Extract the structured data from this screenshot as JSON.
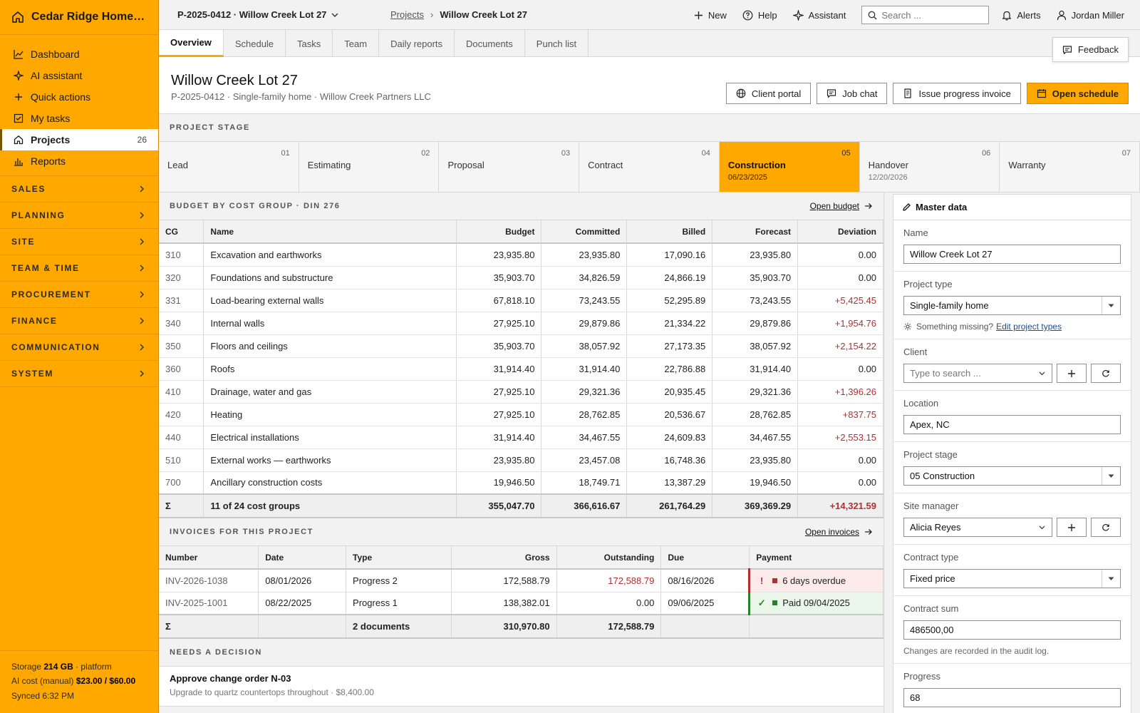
{
  "brand": {
    "name": "Cedar Ridge Homes L..."
  },
  "nav": [
    {
      "label": "Dashboard",
      "icon": "chart-line-icon"
    },
    {
      "label": "AI assistant",
      "icon": "sparkle-icon"
    },
    {
      "label": "Quick actions",
      "icon": "plus-icon"
    },
    {
      "label": "My tasks",
      "icon": "checkbox-icon"
    },
    {
      "label": "Projects",
      "icon": "home-icon",
      "count": "26",
      "active": true
    },
    {
      "label": "Reports",
      "icon": "bar-chart-icon"
    }
  ],
  "groups": [
    "SALES",
    "PLANNING",
    "SITE",
    "TEAM & TIME",
    "PROCUREMENT",
    "FINANCE",
    "COMMUNICATION",
    "SYSTEM"
  ],
  "footer": {
    "storage_label": "Storage",
    "storage_value": "214 GB",
    "storage_suffix": "· platform",
    "ai_label": "AI cost (manual)",
    "ai_value": "$23.00 / $60.00",
    "synced": "Synced 6:32 PM"
  },
  "topbar": {
    "project": "P-2025-0412 · Willow Creek Lot 27",
    "crumb_parent": "Projects",
    "crumb_current": "Willow Creek Lot 27",
    "new_label": "New",
    "help_label": "Help",
    "assistant_label": "Assistant",
    "search_placeholder": "Search ...",
    "alerts_label": "Alerts",
    "user_name": "Jordan Miller"
  },
  "tabs": [
    "Overview",
    "Schedule",
    "Tasks",
    "Team",
    "Daily reports",
    "Documents",
    "Punch list"
  ],
  "feedback_label": "Feedback",
  "header": {
    "title": "Willow Creek Lot 27",
    "subtitle": "P-2025-0412 · Single-family home · Willow Creek Partners LLC",
    "btn_client_portal": "Client portal",
    "btn_job_chat": "Job chat",
    "btn_invoice": "Issue progress invoice",
    "btn_schedule": "Open schedule"
  },
  "stage_label": "PROJECT STAGE",
  "stages": [
    {
      "num": "01",
      "name": "Lead",
      "date": ""
    },
    {
      "num": "02",
      "name": "Estimating",
      "date": ""
    },
    {
      "num": "03",
      "name": "Proposal",
      "date": ""
    },
    {
      "num": "04",
      "name": "Contract",
      "date": ""
    },
    {
      "num": "05",
      "name": "Construction",
      "date": "06/23/2025",
      "active": true
    },
    {
      "num": "06",
      "name": "Handover",
      "date": "12/20/2026"
    },
    {
      "num": "07",
      "name": "Warranty",
      "date": ""
    }
  ],
  "budget": {
    "title": "BUDGET BY COST GROUP · DIN 276",
    "link": "Open budget",
    "columns": [
      "CG",
      "Name",
      "Budget",
      "Committed",
      "Billed",
      "Forecast",
      "Deviation"
    ],
    "rows": [
      [
        "310",
        "Excavation and earthworks",
        "23,935.80",
        "23,935.80",
        "17,090.16",
        "23,935.80",
        "0.00"
      ],
      [
        "320",
        "Foundations and substructure",
        "35,903.70",
        "34,826.59",
        "24,866.19",
        "35,903.70",
        "0.00"
      ],
      [
        "331",
        "Load-bearing external walls",
        "67,818.10",
        "73,243.55",
        "52,295.89",
        "73,243.55",
        "+5,425.45"
      ],
      [
        "340",
        "Internal walls",
        "27,925.10",
        "29,879.86",
        "21,334.22",
        "29,879.86",
        "+1,954.76"
      ],
      [
        "350",
        "Floors and ceilings",
        "35,903.70",
        "38,057.92",
        "27,173.35",
        "38,057.92",
        "+2,154.22"
      ],
      [
        "360",
        "Roofs",
        "31,914.40",
        "31,914.40",
        "22,786.88",
        "31,914.40",
        "0.00"
      ],
      [
        "410",
        "Drainage, water and gas",
        "27,925.10",
        "29,321.36",
        "20,935.45",
        "29,321.36",
        "+1,396.26"
      ],
      [
        "420",
        "Heating",
        "27,925.10",
        "28,762.85",
        "20,536.67",
        "28,762.85",
        "+837.75"
      ],
      [
        "440",
        "Electrical installations",
        "31,914.40",
        "34,467.55",
        "24,609.83",
        "34,467.55",
        "+2,553.15"
      ],
      [
        "510",
        "External works — earthworks",
        "23,935.80",
        "23,457.08",
        "16,748.36",
        "23,935.80",
        "0.00"
      ],
      [
        "700",
        "Ancillary construction costs",
        "19,946.50",
        "18,749.71",
        "13,387.29",
        "19,946.50",
        "0.00"
      ]
    ],
    "total": [
      "Σ",
      "11 of 24 cost groups",
      "355,047.70",
      "366,616.67",
      "261,764.29",
      "369,369.29",
      "+14,321.59"
    ]
  },
  "invoices": {
    "title": "INVOICES FOR THIS PROJECT",
    "link": "Open invoices",
    "columns": [
      "Number",
      "Date",
      "Type",
      "Gross",
      "Outstanding",
      "Due",
      "Payment"
    ],
    "rows": [
      {
        "number": "INV-2026-1038",
        "date": "08/01/2026",
        "type": "Progress 2",
        "gross": "172,588.79",
        "outstanding": "172,588.79",
        "due": "08/16/2026",
        "payment": "6 days overdue",
        "mark": "!",
        "status": "overdue"
      },
      {
        "number": "INV-2025-1001",
        "date": "08/22/2025",
        "type": "Progress 1",
        "gross": "138,382.01",
        "outstanding": "0.00",
        "due": "09/06/2025",
        "payment": "Paid 09/04/2025",
        "mark": "✓",
        "status": "paid"
      }
    ],
    "total": {
      "sigma": "Σ",
      "label": "2 documents",
      "gross": "310,970.80",
      "outstanding": "172,588.79"
    }
  },
  "decision": {
    "title": "NEEDS A DECISION",
    "item_title": "Approve change order N-03",
    "item_sub": "Upgrade to quartz countertops throughout · $8,400.00"
  },
  "master": {
    "title": "Master data",
    "name_label": "Name",
    "name_value": "Willow Creek Lot 27",
    "type_label": "Project type",
    "type_value": "Single-family home",
    "missing_text": "Something missing?",
    "missing_link": "Edit project types",
    "client_label": "Client",
    "client_placeholder": "Type to search ...",
    "location_label": "Location",
    "location_value": "Apex, NC",
    "stage_label": "Project stage",
    "stage_value": "05 Construction",
    "manager_label": "Site manager",
    "manager_value": "Alicia Reyes",
    "contract_type_label": "Contract type",
    "contract_type_value": "Fixed price",
    "contract_sum_label": "Contract sum",
    "contract_sum_value": "486500,00",
    "audit_note": "Changes are recorded in the audit log.",
    "progress_label": "Progress",
    "progress_value": "68"
  },
  "colors": {
    "accent": "#ffa800",
    "negative": "#b03030",
    "positive": "#2f7d32"
  }
}
